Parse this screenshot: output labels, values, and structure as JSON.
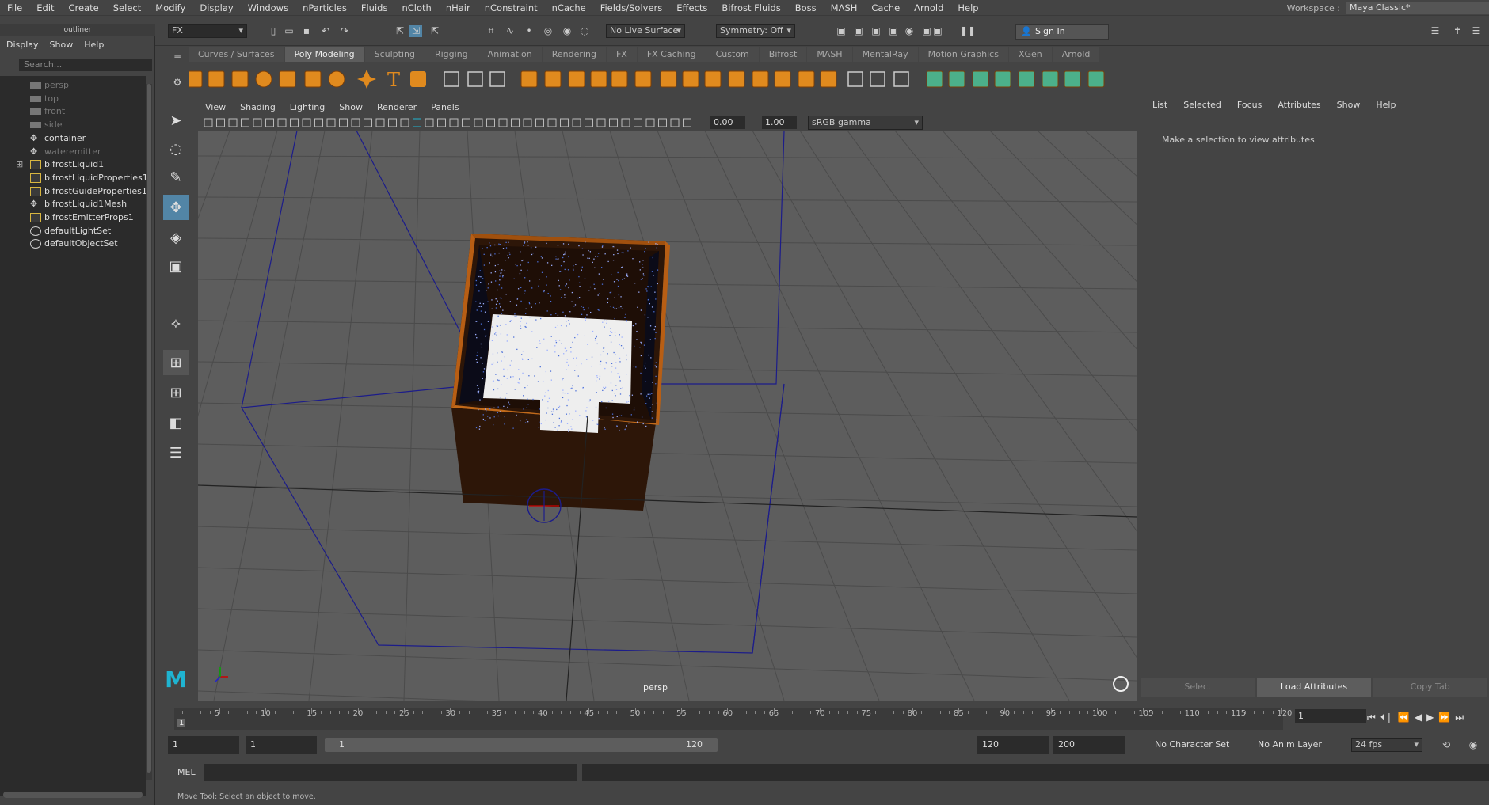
{
  "menu": [
    "File",
    "Edit",
    "Create",
    "Select",
    "Modify",
    "Display",
    "Windows",
    "nParticles",
    "Fluids",
    "nCloth",
    "nHair",
    "nConstraint",
    "nCache",
    "Fields/Solvers",
    "Effects",
    "Bifrost Fluids",
    "Boss",
    "MASH",
    "Cache",
    "Arnold",
    "Help"
  ],
  "workspace": {
    "label": "Workspace :",
    "value": "Maya Classic*"
  },
  "status": {
    "menu_set": "FX",
    "live_surface": "No Live Surface",
    "symmetry": "Symmetry: Off",
    "sign_in": "Sign In"
  },
  "outliner": {
    "title": "outliner",
    "menu": [
      "Display",
      "Show",
      "Help"
    ],
    "search_placeholder": "Search...",
    "items": [
      {
        "label": "persp",
        "dim": true,
        "icon": "camera-icon"
      },
      {
        "label": "top",
        "dim": true,
        "icon": "camera-icon"
      },
      {
        "label": "front",
        "dim": true,
        "icon": "camera-icon"
      },
      {
        "label": "side",
        "dim": true,
        "icon": "camera-icon"
      },
      {
        "label": "container",
        "dim": false,
        "icon": "transform-icon"
      },
      {
        "label": "wateremitter",
        "dim": true,
        "icon": "transform-icon"
      },
      {
        "label": "bifrostLiquid1",
        "dim": false,
        "icon": "node-icon"
      },
      {
        "label": "bifrostLiquidProperties1",
        "dim": false,
        "icon": "node-icon"
      },
      {
        "label": "bifrostGuideProperties1",
        "dim": false,
        "icon": "node-icon"
      },
      {
        "label": "bifrostLiquid1Mesh",
        "dim": false,
        "icon": "transform-icon"
      },
      {
        "label": "bifrostEmitterProps1",
        "dim": false,
        "icon": "node-icon"
      },
      {
        "label": "defaultLightSet",
        "dim": false,
        "icon": "set-icon"
      },
      {
        "label": "defaultObjectSet",
        "dim": false,
        "icon": "set-icon"
      }
    ]
  },
  "shelf_tabs": [
    "Curves / Surfaces",
    "Poly Modeling",
    "Sculpting",
    "Rigging",
    "Animation",
    "Rendering",
    "FX",
    "FX Caching",
    "Custom",
    "Bifrost",
    "MASH",
    "MentalRay",
    "Motion Graphics",
    "XGen",
    "Arnold"
  ],
  "shelf_active": "Poly Modeling",
  "panel_menu": [
    "View",
    "Shading",
    "Lighting",
    "Show",
    "Renderer",
    "Panels"
  ],
  "panel_toolbar": {
    "exposure": "0.00",
    "gamma": "1.00",
    "color_space": "sRGB gamma"
  },
  "viewport": {
    "camera_label": "persp"
  },
  "attribute_editor": {
    "menu": [
      "List",
      "Selected",
      "Focus",
      "Attributes",
      "Show",
      "Help"
    ],
    "message": "Make a selection to view attributes",
    "buttons": [
      "Select",
      "Load Attributes",
      "Copy Tab"
    ]
  },
  "timeline": {
    "ticks": [
      "5",
      "10",
      "15",
      "20",
      "25",
      "30",
      "35",
      "40",
      "45",
      "50",
      "55",
      "60",
      "65",
      "70",
      "75",
      "80",
      "85",
      "90",
      "95",
      "100",
      "105",
      "110",
      "115",
      "120"
    ],
    "start_marker": "1",
    "current_frame": "1"
  },
  "range": {
    "start": "1",
    "anim_start": "1",
    "slider_start": "1",
    "slider_end": "120",
    "end": "120",
    "anim_end": "200",
    "character_set": "No Character Set",
    "anim_layer": "No Anim Layer",
    "fps": "24 fps"
  },
  "cmd": {
    "label": "MEL"
  },
  "help_line": "Move Tool: Select an object to move."
}
